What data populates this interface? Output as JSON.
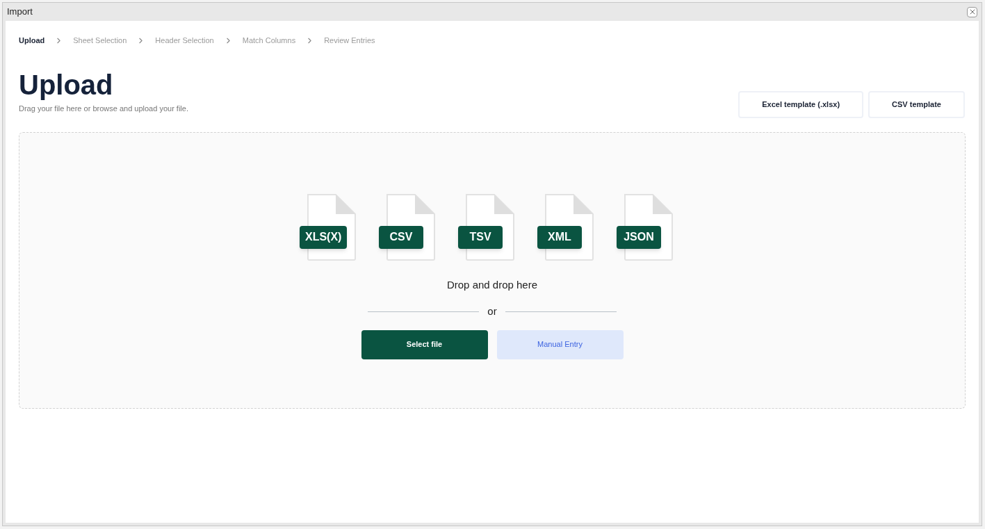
{
  "window": {
    "title": "Import"
  },
  "steps": [
    {
      "label": "Upload",
      "selected": true
    },
    {
      "label": "Sheet Selection",
      "selected": false
    },
    {
      "label": "Header Selection",
      "selected": false
    },
    {
      "label": "Match Columns",
      "selected": false
    },
    {
      "label": "Review Entries",
      "selected": false
    }
  ],
  "heading": "Upload",
  "subtitle": "Drag your file here or browse and upload your file.",
  "template_buttons": [
    "Excel template (.xlsx)",
    "CSV template"
  ],
  "dropzone": {
    "formats": [
      "XLS(X)",
      "CSV",
      "TSV",
      "XML",
      "JSON"
    ],
    "prompt": "Drop and drop here",
    "separator": "or",
    "buttons": [
      {
        "label": "Select file",
        "kind": "primary"
      },
      {
        "label": "Manual Entry",
        "kind": "secondary"
      }
    ]
  }
}
